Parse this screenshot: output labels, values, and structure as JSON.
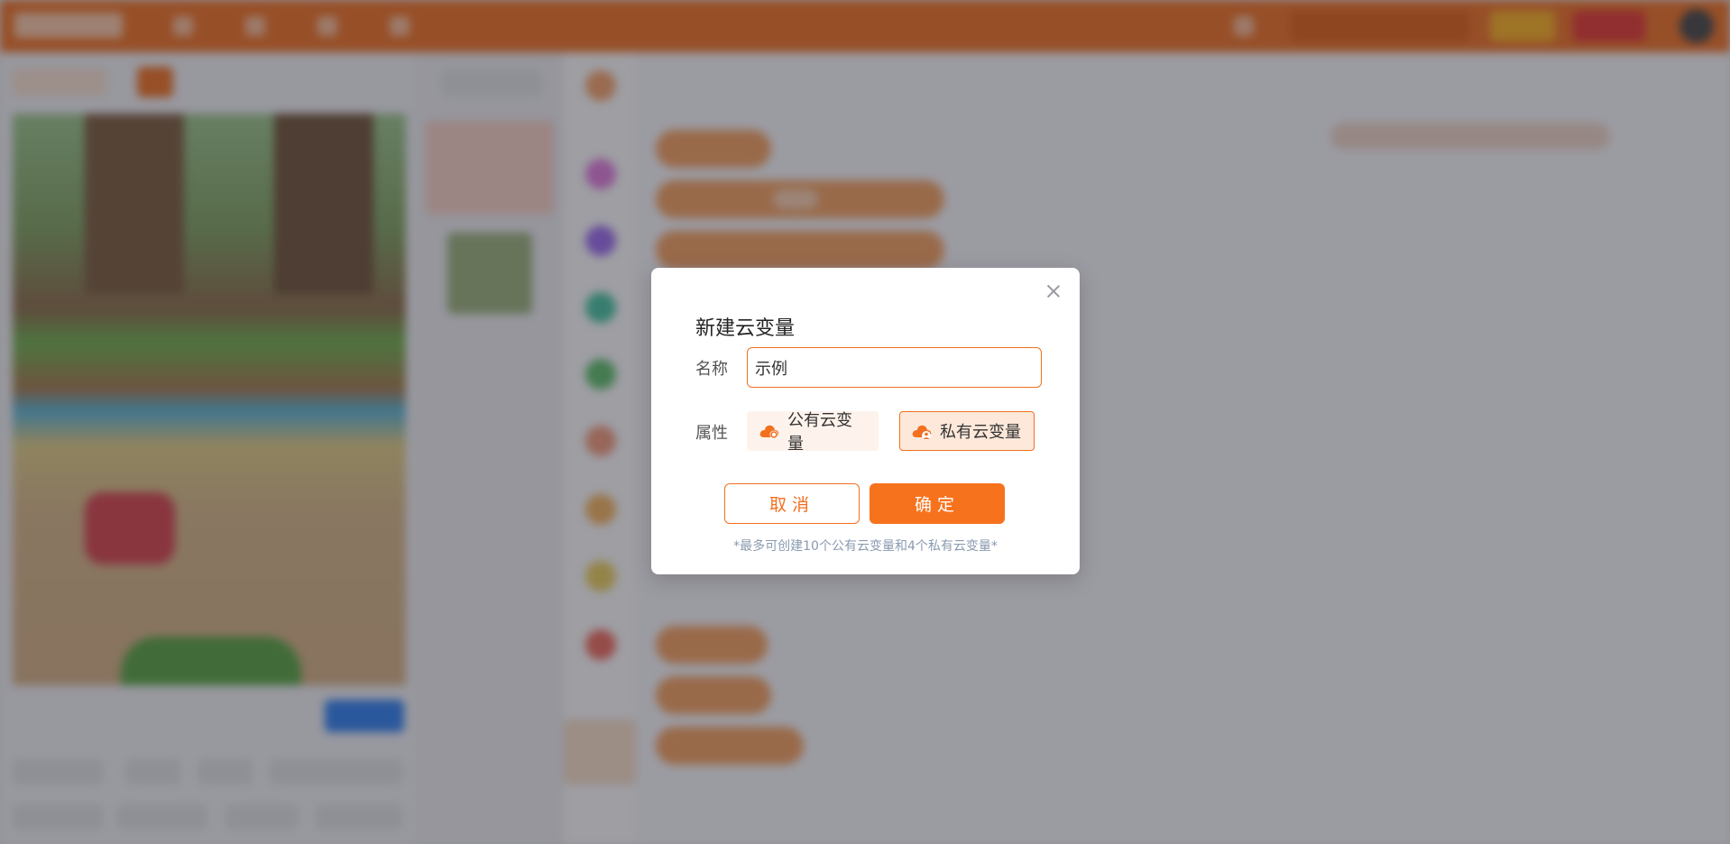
{
  "dialog": {
    "title": "新建云变量",
    "name_label": "名称",
    "name_value": "示例",
    "property_label": "属性",
    "options": [
      {
        "label": "公有云变量",
        "icon": "cloud-public-icon",
        "selected": false
      },
      {
        "label": "私有云变量",
        "icon": "cloud-private-icon",
        "selected": true
      }
    ],
    "cancel_label": "取消",
    "ok_label": "确定",
    "hint": "*最多可创建10个公有云变量和4个私有云变量*"
  },
  "colors": {
    "accent": "#f2701f",
    "selected_bg": "#fde8da",
    "hint": "#8a9ab0"
  }
}
